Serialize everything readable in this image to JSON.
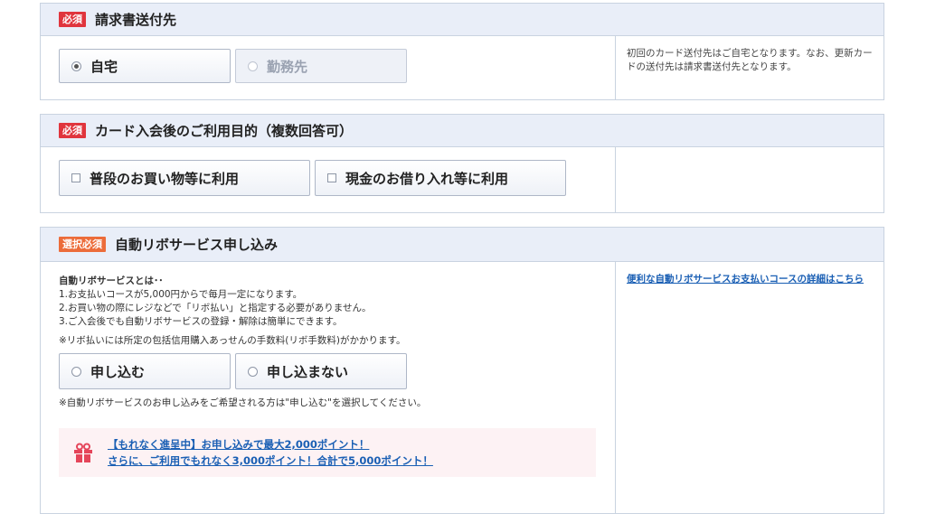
{
  "billing": {
    "badge": "必須",
    "title": "請求書送付先",
    "options": [
      {
        "label": "自宅",
        "selected": true,
        "disabled": false
      },
      {
        "label": "勤務先",
        "selected": false,
        "disabled": true
      }
    ],
    "note": "初回のカード送付先はご自宅となります。なお、更新カードの送付先は請求書送付先となります。"
  },
  "purpose": {
    "badge": "必須",
    "title": "カード入会後のご利用目的（複数回答可）",
    "options": [
      {
        "label": "普段のお買い物等に利用",
        "checked": false
      },
      {
        "label": "現金のお借り入れ等に利用",
        "checked": false
      }
    ]
  },
  "revo": {
    "badge": "選択必須",
    "title": "自動リボサービス申し込み",
    "intro_heading": "自動リボサービスとは･･",
    "intro_lines": [
      "1.お支払いコースが5,000円からで毎月一定になります。",
      "2.お買い物の際にレジなどで「リボ払い」と指定する必要がありません。",
      "3.ご入会後でも自動リボサービスの登録・解除は簡単にできます。"
    ],
    "fee_note": "※リボ払いには所定の包括信用購入あっせんの手数料(リボ手数料)がかかります。",
    "options": [
      {
        "label": "申し込む",
        "selected": false
      },
      {
        "label": "申し込まない",
        "selected": false
      }
    ],
    "select_note": "※自動リボサービスのお申し込みをご希望される方は\"申し込む\"を選択してください。",
    "promo_line1": "【もれなく進呈中】お申し込みで最大2,000ポイント！",
    "promo_line2": "さらに、ご利用でもれなく3,000ポイント！合計で5,000ポイント！",
    "side_link": "便利な自動リボサービスお支払いコースの詳細はこちら"
  },
  "colors": {
    "badge_red": "#e0353d",
    "badge_orange": "#ec6c3a",
    "header_bg": "#e9eef8",
    "link": "#1a5fb4",
    "promo_bg": "#fdf2f4",
    "gift_icon": "#e5455a"
  }
}
